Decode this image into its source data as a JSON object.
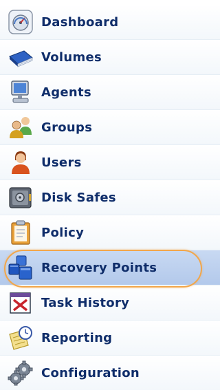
{
  "sidebar": {
    "items": [
      {
        "label": "Dashboard",
        "icon": "dashboard-icon"
      },
      {
        "label": "Volumes",
        "icon": "volumes-icon"
      },
      {
        "label": "Agents",
        "icon": "agents-icon"
      },
      {
        "label": "Groups",
        "icon": "groups-icon"
      },
      {
        "label": "Users",
        "icon": "users-icon"
      },
      {
        "label": "Disk Safes",
        "icon": "disk-safes-icon"
      },
      {
        "label": "Policy",
        "icon": "policy-icon"
      },
      {
        "label": "Recovery Points",
        "icon": "recovery-points-icon",
        "active": true
      },
      {
        "label": "Task History",
        "icon": "task-history-icon"
      },
      {
        "label": "Reporting",
        "icon": "reporting-icon"
      },
      {
        "label": "Configuration",
        "icon": "configuration-icon"
      }
    ],
    "colors": {
      "label": "#0f2d6a",
      "active_background": "#bcd0ee",
      "highlight_ring": "#f2a64a"
    }
  }
}
